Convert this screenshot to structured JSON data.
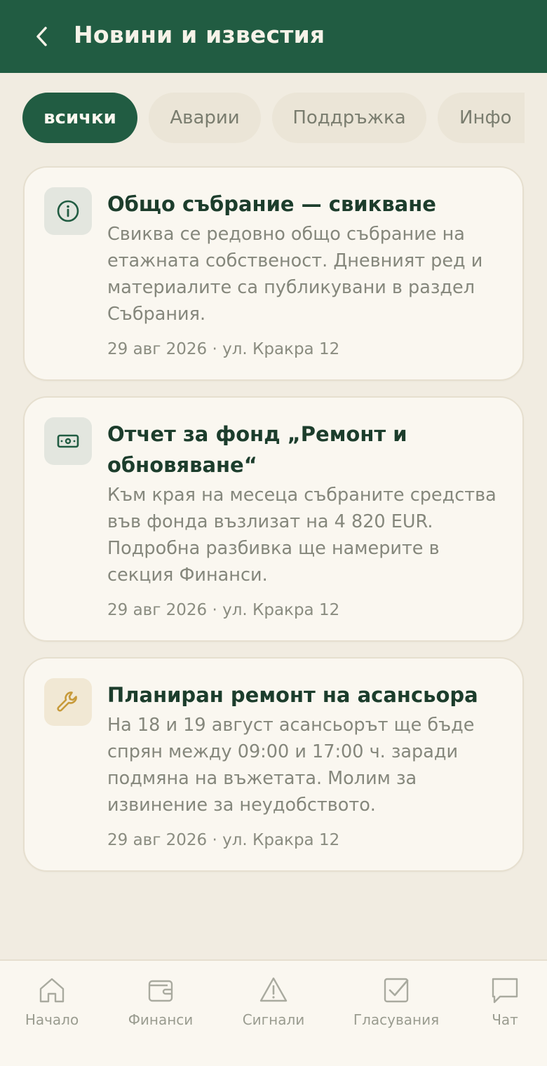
{
  "header": {
    "title": "Новини и известия"
  },
  "tabs": [
    {
      "label": "всички",
      "active": true
    },
    {
      "label": "Аварии",
      "active": false
    },
    {
      "label": "Поддръжка",
      "active": false
    },
    {
      "label": "Инфо",
      "active": false
    }
  ],
  "cards": [
    {
      "icon": "info-icon",
      "title": "Общо събрание — свикване",
      "body": "Свиква се редовно общо събрание на етажната собственост. Дневният ред и материалите са публикувани в раздел Събрания.",
      "meta": "29 авг 2026 · ул. Кракра 12"
    },
    {
      "icon": "money-icon",
      "title": "Отчет за фонд „Ремонт и обновяване“",
      "body": "Към края на месеца събраните средства във фонда възлизат на 4 820 EUR. Подробна разбивка ще намерите в секция Финанси.",
      "meta": "29 авг 2026 · ул. Кракра 12"
    },
    {
      "icon": "wrench-icon",
      "title": "Планиран ремонт на асансьора",
      "body": "На 18 и 19 август асансьорът ще бъде спрян между 09:00 и 17:00 ч. заради подмяна на въжетата. Молим за извинение за неудобството.",
      "meta": "29 авг 2026 · ул. Кракра 12"
    }
  ],
  "nav": [
    {
      "label": "Начало",
      "icon": "home-icon"
    },
    {
      "label": "Финанси",
      "icon": "wallet-icon"
    },
    {
      "label": "Сигнали",
      "icon": "warning-icon"
    },
    {
      "label": "Гласувания",
      "icon": "checkbox-icon"
    },
    {
      "label": "Чат",
      "icon": "chat-icon"
    }
  ],
  "colors": {
    "header_bg": "#215c42",
    "page_bg": "#f1ece1",
    "card_bg": "#faf7f0",
    "accent_gold": "#c79a3a"
  }
}
